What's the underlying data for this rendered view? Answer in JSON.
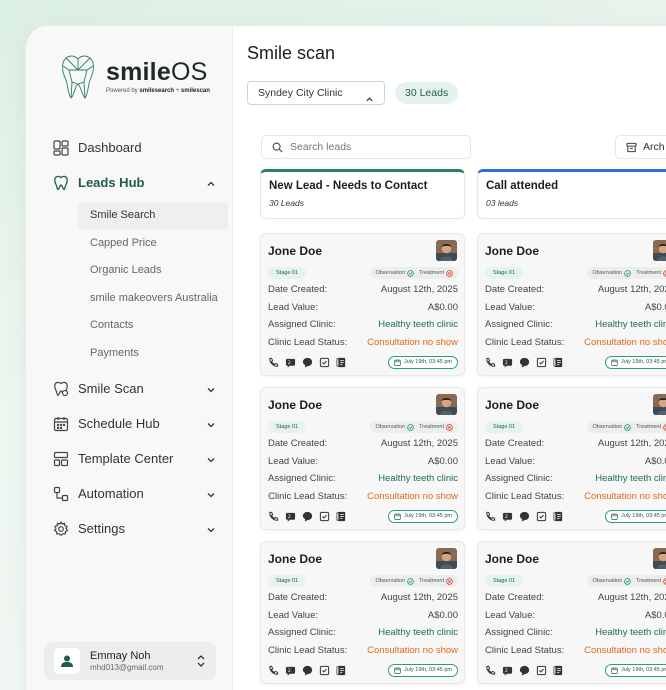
{
  "brand": {
    "name_main": "smile",
    "name_os": "OS",
    "powered_prefix": "Powered by",
    "powered_a": "smilesearch",
    "powered_sep": " + ",
    "powered_b": "smilescan",
    "logo_icon": "tooth-icon"
  },
  "sidebar": {
    "items": [
      {
        "label": "Dashboard",
        "icon": "dashboard-icon"
      },
      {
        "label": "Leads Hub",
        "icon": "tooth-outline-icon"
      },
      {
        "label": "Smile Scan",
        "icon": "smile-scan-icon"
      },
      {
        "label": "Schedule Hub",
        "icon": "calendar-icon"
      },
      {
        "label": "Template Center",
        "icon": "template-icon"
      },
      {
        "label": "Automation",
        "icon": "automation-icon"
      },
      {
        "label": "Settings",
        "icon": "gear-icon"
      }
    ],
    "leads_sub": [
      "Smile Search",
      "Capped Price",
      "Organic Leads",
      "smile makeovers Australia",
      "Contacts",
      "Payments"
    ]
  },
  "user": {
    "name": "Emmay Noh",
    "email": "mhd013@gmail.com"
  },
  "main": {
    "title": "Smile scan",
    "clinic": "Syndey City Clinic",
    "leads_badge": "30 Leads",
    "search_placeholder": "Search leads",
    "archive_label": "Arch"
  },
  "columns": [
    {
      "title": "New Lead - Needs to Contact",
      "count": "30 Leads",
      "accent": "#2e7d68"
    },
    {
      "title": "Call attended",
      "count": "03 leads",
      "accent": "#2f6fd6"
    }
  ],
  "card": {
    "name": "Jone Doe",
    "stage": "Stage 01",
    "observation": "Observation",
    "treatment": "Treatment",
    "labels": {
      "created": "Date Created:",
      "value": "Lead Value:",
      "clinic": "Assigned Clinic:",
      "status": "Clinic Lead Status:"
    },
    "values": {
      "created": "August 12th, 2025",
      "value": "A$0.00",
      "clinic": "Healthy teeth clinic",
      "status": "Consultation no show"
    },
    "appointment": "July 19th, 03:45 pm"
  },
  "colors": {
    "green": "#1f5c4d",
    "orange": "#e06a1a",
    "blue": "#2f6fd6"
  }
}
